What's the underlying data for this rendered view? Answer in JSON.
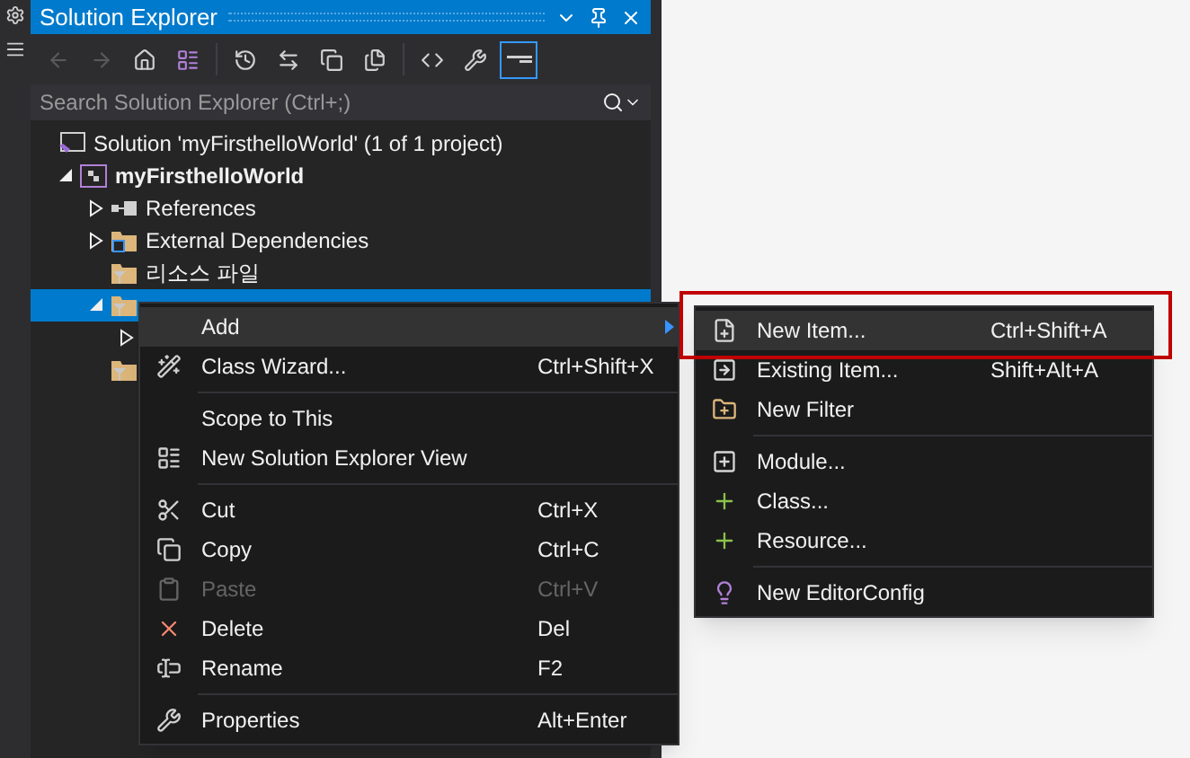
{
  "panel": {
    "title": "Solution Explorer",
    "toolbar": [
      {
        "disabled": true,
        "selected": false
      },
      {
        "disabled": true,
        "selected": false
      },
      {
        "disabled": false,
        "selected": false
      },
      {
        "disabled": false,
        "selected": false
      },
      {
        "disabled": false,
        "selected": false
      },
      {
        "disabled": false,
        "selected": false
      },
      {
        "disabled": false,
        "selected": false
      },
      {
        "disabled": false,
        "selected": false
      },
      {
        "disabled": false,
        "selected": false
      },
      {
        "disabled": false,
        "selected": false
      },
      {
        "disabled": false,
        "selected": true
      }
    ],
    "search": {
      "placeholder": "Search Solution Explorer (Ctrl+;)"
    },
    "tree": [
      {
        "kind": "solution",
        "label": "Solution 'myFirsthelloWorld' (1 of 1 project)",
        "selected": false,
        "children": [
          {
            "kind": "project",
            "label": "myFirsthelloWorld",
            "expanded": true,
            "selected": false,
            "children": [
              {
                "kind": "references",
                "label": "References",
                "expanded": false,
                "selected": false
              },
              {
                "kind": "external",
                "label": "External Dependencies",
                "expanded": false,
                "selected": false
              },
              {
                "kind": "filter",
                "label": "리소스 파일",
                "selected": false
              },
              {
                "kind": "filter",
                "expanded": true,
                "selected": true,
                "children": [
                  {
                    "expanded": false,
                    "selected": false
                  }
                ]
              },
              {
                "kind": "filter",
                "selected": false
              }
            ]
          }
        ]
      }
    ]
  },
  "context_menu": {
    "items": [
      {
        "kind": "item",
        "label": "Add",
        "submenu": true,
        "selected": true,
        "disabled": false
      },
      {
        "kind": "item",
        "label": "Class Wizard...",
        "shortcut": "Ctrl+Shift+X",
        "selected": false,
        "disabled": false
      },
      {
        "kind": "separator"
      },
      {
        "kind": "item",
        "label": "Scope to This",
        "selected": false,
        "disabled": false
      },
      {
        "kind": "item",
        "label": "New Solution Explorer View",
        "selected": false,
        "disabled": false
      },
      {
        "kind": "separator"
      },
      {
        "kind": "item",
        "label": "Cut",
        "shortcut": "Ctrl+X",
        "selected": false,
        "disabled": false
      },
      {
        "kind": "item",
        "label": "Copy",
        "shortcut": "Ctrl+C",
        "selected": false,
        "disabled": false
      },
      {
        "kind": "item",
        "label": "Paste",
        "shortcut": "Ctrl+V",
        "selected": false,
        "disabled": true
      },
      {
        "kind": "item",
        "label": "Delete",
        "shortcut": "Del",
        "selected": false,
        "disabled": false
      },
      {
        "kind": "item",
        "label": "Rename",
        "shortcut": "F2",
        "selected": false,
        "disabled": false
      },
      {
        "kind": "separator"
      },
      {
        "kind": "item",
        "label": "Properties",
        "shortcut": "Alt+Enter",
        "selected": false,
        "disabled": false
      }
    ]
  },
  "submenu": {
    "items": [
      {
        "kind": "item",
        "label": "New Item...",
        "shortcut": "Ctrl+Shift+A",
        "selected": true,
        "disabled": false
      },
      {
        "kind": "item",
        "label": "Existing Item...",
        "shortcut": "Shift+Alt+A",
        "selected": false,
        "disabled": false
      },
      {
        "kind": "item",
        "label": "New Filter",
        "selected": false,
        "disabled": false
      },
      {
        "kind": "separator"
      },
      {
        "kind": "item",
        "label": "Module...",
        "selected": false,
        "disabled": false
      },
      {
        "kind": "item",
        "label": "Class...",
        "selected": false,
        "disabled": false
      },
      {
        "kind": "item",
        "label": "Resource...",
        "selected": false,
        "disabled": false
      },
      {
        "kind": "separator"
      },
      {
        "kind": "item",
        "label": "New EditorConfig",
        "selected": false,
        "disabled": false
      }
    ],
    "highlighted": true
  }
}
